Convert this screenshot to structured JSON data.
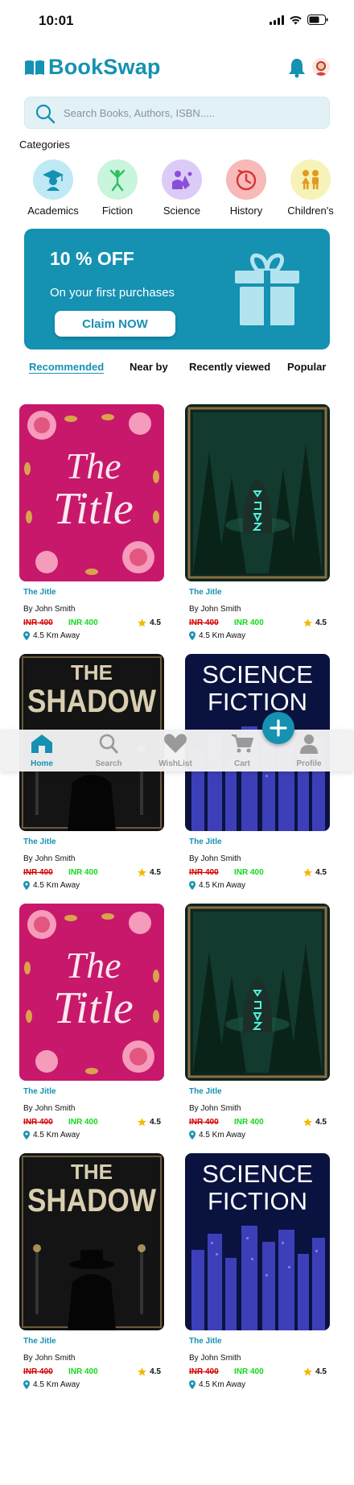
{
  "status": {
    "time": "10:01"
  },
  "header": {
    "title": "BookSwap"
  },
  "search": {
    "placeholder": "Search Books, Authors, ISBN....."
  },
  "categories": {
    "title": "Categories",
    "items": [
      {
        "label": "Academics",
        "icon": "student-icon",
        "color": "#bfe9f5"
      },
      {
        "label": "Fiction",
        "icon": "fiction-icon",
        "color": "#c8f5dc"
      },
      {
        "label": "Science",
        "icon": "science-icon",
        "color": "#dccbf7"
      },
      {
        "label": "History",
        "icon": "history-icon",
        "color": "#f8b9b9"
      },
      {
        "label": "Children's",
        "icon": "children-icon",
        "color": "#f7f3b8"
      }
    ]
  },
  "promo": {
    "title": "10 % OFF",
    "subtitle": "On your first purchases",
    "button": "Claim NOW"
  },
  "tabs": [
    {
      "label": "Recommended",
      "active": true
    },
    {
      "label": "Near by"
    },
    {
      "label": "Recently viewed"
    },
    {
      "label": "Popular"
    }
  ],
  "books": [
    {
      "cover": "title",
      "cover_text": [
        "The",
        "Title"
      ],
      "title": "The Jitle",
      "author": "By John Smith",
      "old_price": "INR 400",
      "new_price": "INR 400",
      "rating": "4.5",
      "distance": "4.5 Km Away"
    },
    {
      "cover": "forest",
      "cover_text": [
        "ᛟ",
        "ᚱ",
        "ᛟ",
        "ᛉ"
      ],
      "title": "The Jitle",
      "author": "By John Smith",
      "old_price": "INR 400",
      "new_price": "INR 400",
      "rating": "4.5",
      "distance": "4.5 Km Away"
    },
    {
      "cover": "shadow",
      "cover_text": [
        "THE",
        "SHADOW"
      ],
      "title": "The Jitle",
      "author": "By John Smith",
      "old_price": "INR 400",
      "new_price": "INR 400",
      "rating": "4.5",
      "distance": "4.5 Km Away"
    },
    {
      "cover": "scifi",
      "cover_text": [
        "SCIENCE",
        "FICTION"
      ],
      "title": "The Jitle",
      "author": "By John Smith",
      "old_price": "INR 400",
      "new_price": "INR 400",
      "rating": "4.5",
      "distance": "4.5 Km Away"
    },
    {
      "cover": "title",
      "cover_text": [
        "The",
        "Title"
      ],
      "title": "The Jitle",
      "author": "By John Smith",
      "old_price": "INR 400",
      "new_price": "INR 400",
      "rating": "4.5",
      "distance": "4.5 Km Away"
    },
    {
      "cover": "forest",
      "cover_text": [
        "ᛟ",
        "ᚱ",
        "ᛟ",
        "ᛉ"
      ],
      "title": "The Jitle",
      "author": "By John Smith",
      "old_price": "INR 400",
      "new_price": "INR 400",
      "rating": "4.5",
      "distance": "4.5 Km Away"
    },
    {
      "cover": "shadow",
      "cover_text": [
        "THE",
        "SHADOW"
      ],
      "title": "The Jitle",
      "author": "By John Smith",
      "old_price": "INR 400",
      "new_price": "INR 400",
      "rating": "4.5",
      "distance": "4.5 Km Away"
    },
    {
      "cover": "scifi",
      "cover_text": [
        "SCIENCE",
        "FICTION"
      ],
      "title": "The Jitle",
      "author": "By John Smith",
      "old_price": "INR 400",
      "new_price": "INR 400",
      "rating": "4.5",
      "distance": "4.5 Km Away"
    }
  ],
  "nav": [
    {
      "label": "Home",
      "icon": "home-icon",
      "active": true
    },
    {
      "label": "Search",
      "icon": "search-icon"
    },
    {
      "label": "WishList",
      "icon": "heart-icon"
    },
    {
      "label": "Cart",
      "icon": "cart-icon"
    },
    {
      "label": "Profile",
      "icon": "profile-icon"
    }
  ],
  "fab": {
    "icon": "plus-icon"
  },
  "colors": {
    "brand": "#1591b2",
    "old_price": "#d40000",
    "new_price": "#13d91c",
    "star": "#f5b800"
  }
}
